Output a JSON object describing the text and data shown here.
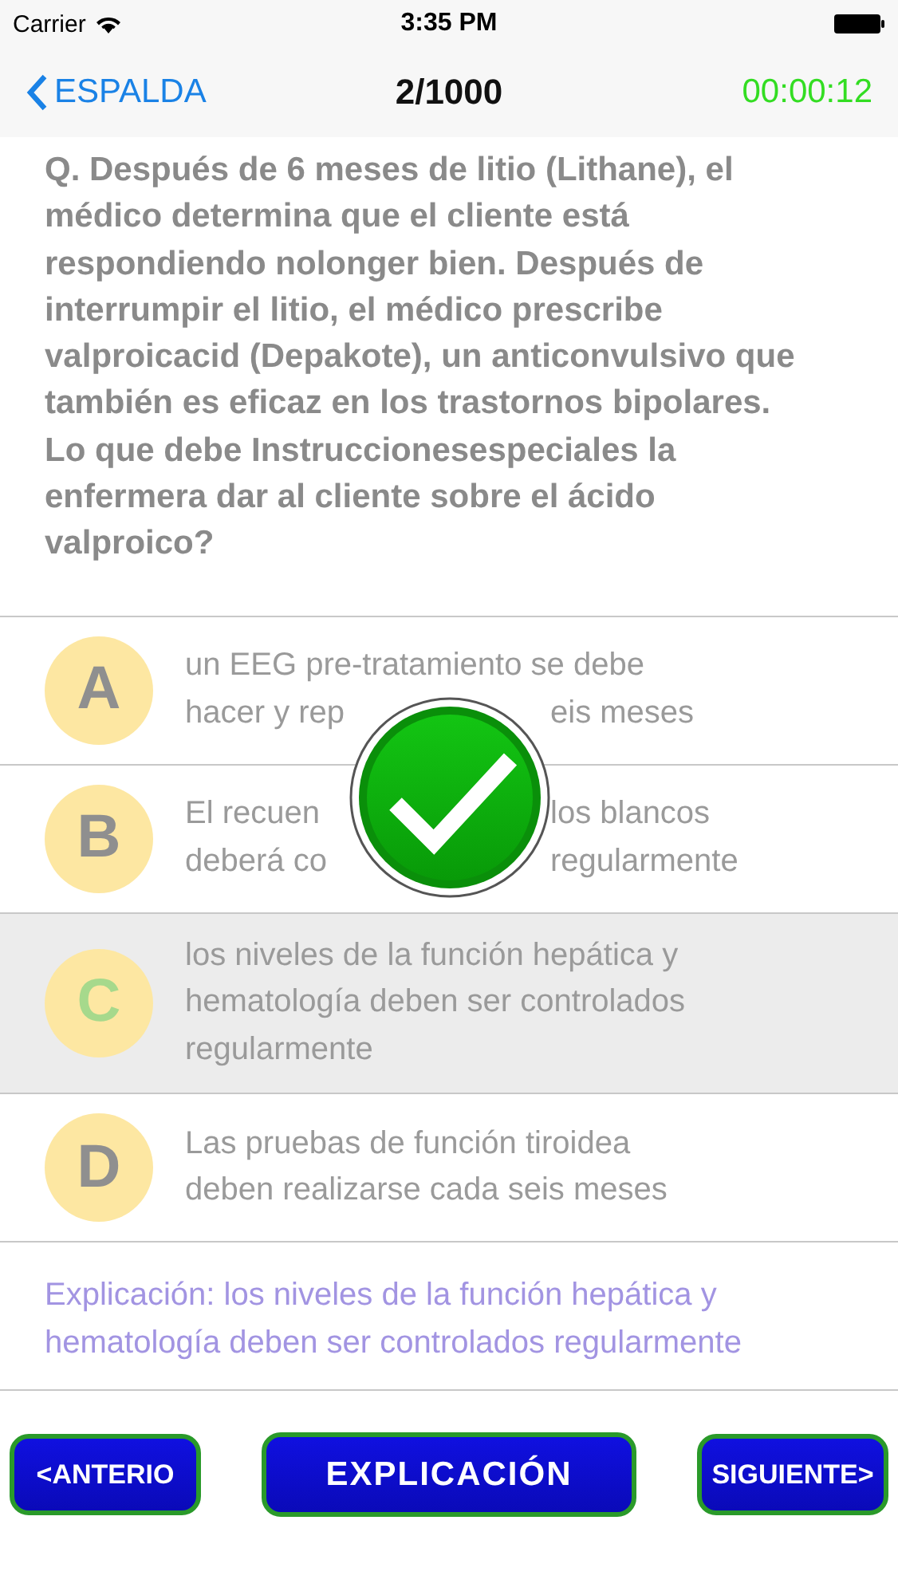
{
  "status_bar": {
    "carrier": "Carrier",
    "time": "3:35 PM"
  },
  "nav": {
    "back": "ESPALDA",
    "counter": "2/1000",
    "timer": "00:00:12"
  },
  "question": "Q. Después de 6 meses de litio (Lithane), el médico determina que el cliente está respondiendo nolonger bien. Después de interrumpir el litio, el médico prescribe valproicacid (Depakote), un anticonvulsivo que también es eficaz en los trastornos bipolares. Lo que debe Instruccionesespeciales la enfermera dar al cliente sobre el ácido valproico?",
  "options": [
    {
      "letter": "A",
      "correct": false,
      "lines": [
        [
          "un EEG pre-tratamiento se debe"
        ],
        [
          "hacer y rep",
          "eis meses"
        ]
      ]
    },
    {
      "letter": "B",
      "correct": false,
      "lines": [
        [
          "El recuen",
          "los blancos"
        ],
        [
          "deberá co",
          "regularmente"
        ]
      ]
    },
    {
      "letter": "C",
      "correct": true,
      "lines": [
        [
          "los niveles de la función hepática y"
        ],
        [
          "hematología deben ser controlados"
        ],
        [
          "regularmente"
        ]
      ]
    },
    {
      "letter": "D",
      "correct": false,
      "lines": [
        [
          "Las pruebas de función tiroidea"
        ],
        [
          "deben realizarse cada seis meses"
        ]
      ]
    }
  ],
  "feedback": {
    "kind": "correct"
  },
  "explanation": "Explicación: los niveles de la función hepática y hematología deben ser controlados regularmente",
  "buttons": [
    {
      "label": "<ANTERIO",
      "kind": "side"
    },
    {
      "label": "EXPLICACIÓN",
      "kind": "main"
    },
    {
      "label": "SIGUIENTE>",
      "kind": "side"
    }
  ]
}
